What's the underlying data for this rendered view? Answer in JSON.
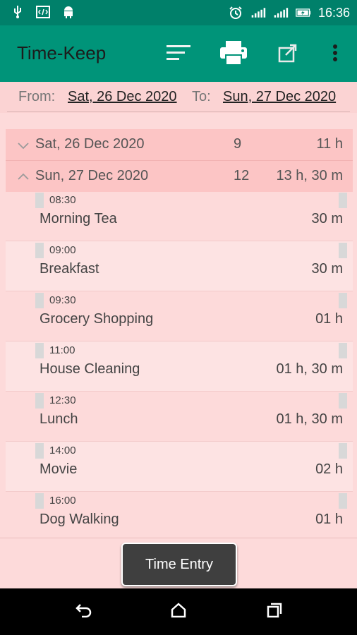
{
  "status_bar": {
    "time": "16:36",
    "icons": [
      "usb-icon",
      "debug-code-icon",
      "android-icon",
      "alarm-icon",
      "signal-1-icon",
      "signal-2-icon",
      "battery-charging-icon"
    ]
  },
  "app_bar": {
    "title": "Time-Keep",
    "actions": [
      "sort-icon",
      "print-icon",
      "share-icon",
      "more-vert-icon"
    ]
  },
  "range": {
    "from_label": "From:",
    "from_value": "Sat, 26 Dec 2020",
    "to_label": "To:",
    "to_value": "Sun, 27 Dec 2020"
  },
  "groups": [
    {
      "date": "Sat, 26 Dec 2020",
      "count": "9",
      "total": "11 h",
      "expanded": false
    },
    {
      "date": "Sun, 27 Dec 2020",
      "count": "12",
      "total": "13 h, 30 m",
      "expanded": true
    }
  ],
  "entries": [
    {
      "time": "08:30",
      "name": "Morning Tea",
      "duration": "30 m"
    },
    {
      "time": "09:00",
      "name": "Breakfast",
      "duration": "30 m"
    },
    {
      "time": "09:30",
      "name": "Grocery Shopping",
      "duration": "01 h"
    },
    {
      "time": "11:00",
      "name": "House Cleaning",
      "duration": "01 h, 30 m"
    },
    {
      "time": "12:30",
      "name": "Lunch",
      "duration": "01 h, 30 m"
    },
    {
      "time": "14:00",
      "name": "Movie",
      "duration": "02 h"
    },
    {
      "time": "16:00",
      "name": "Dog Walking",
      "duration": "01 h"
    }
  ],
  "bottom": {
    "time_entry_label": "Time Entry"
  },
  "nav_bar": {
    "buttons": [
      "back-icon",
      "home-icon",
      "recents-icon"
    ]
  },
  "colors": {
    "status_bar": "#00806a",
    "app_bar": "#009479",
    "background": "#fddada",
    "group_row": "#fcc5c5",
    "alt_row": "#fde3e3",
    "button": "#3f3f3f"
  }
}
